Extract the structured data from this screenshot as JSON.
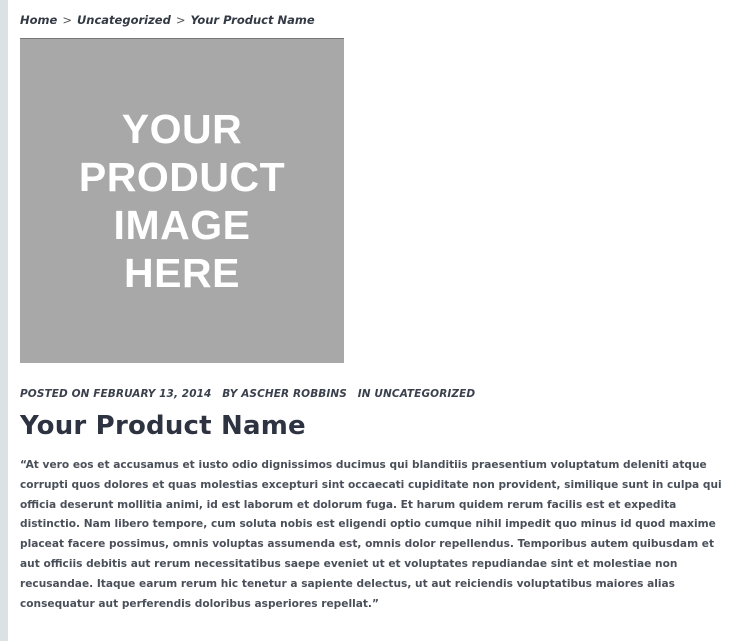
{
  "breadcrumb": {
    "items": [
      "Home",
      "Uncategorized",
      "Your Product Name"
    ],
    "separator": ">"
  },
  "image_placeholder": {
    "lines": [
      "YOUR",
      "PRODUCT",
      "IMAGE",
      "HERE"
    ]
  },
  "post_meta": {
    "posted": "POSTED ON FEBRUARY 13, 2014",
    "author": "BY ASCHER ROBBINS",
    "category": "IN UNCATEGORIZED"
  },
  "post": {
    "title": "Your Product Name",
    "body": "“At vero eos et accusamus et iusto odio dignissimos ducimus qui blanditiis praesentium voluptatum deleniti atque corrupti quos dolores et quas molestias excepturi sint occaecati cupiditate non provident, similique sunt in culpa qui officia deserunt mollitia animi, id est laborum et dolorum fuga. Et harum quidem rerum facilis est et expedita distinctio. Nam libero tempore, cum soluta nobis est eligendi optio cumque nihil impedit quo minus id quod maxime placeat facere possimus, omnis voluptas assumenda est, omnis dolor repellendus. Temporibus autem quibusdam et aut officiis debitis aut rerum necessitatibus saepe eveniet ut et voluptates repudiandae sint et molestiae non recusandae. Itaque earum rerum hic tenetur a sapiente delectus, ut aut reiciendis voluptatibus maiores alias consequatur aut perferendis doloribus asperiores repellat.”"
  },
  "colors": {
    "page_background": "#dbe2e6",
    "content_background": "#ffffff",
    "image_placeholder": "#a8a8a8",
    "title_text": "#2d3340",
    "body_text": "#4a505a"
  }
}
